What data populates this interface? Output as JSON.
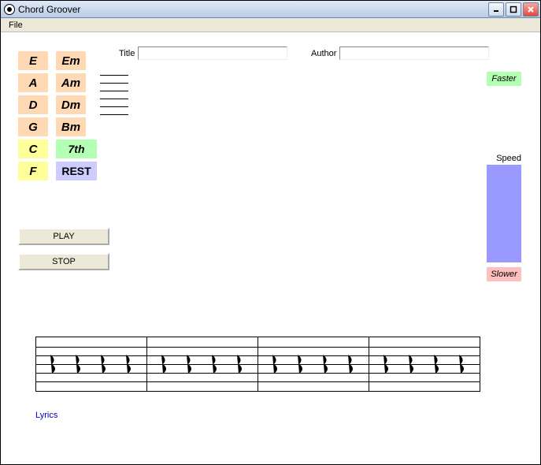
{
  "window": {
    "title": "Chord Groover",
    "menu": {
      "file": "File"
    },
    "buttons": {
      "min": "_",
      "max": "□",
      "close": "X"
    }
  },
  "chords": {
    "col1": [
      "E",
      "A",
      "D",
      "G",
      "C",
      "F"
    ],
    "col2": [
      "Em",
      "Am",
      "Dm",
      "Bm",
      "7th",
      "REST"
    ]
  },
  "fields": {
    "title_label": "Title",
    "title_value": "",
    "author_label": "Author",
    "author_value": ""
  },
  "speed": {
    "faster": "Faster",
    "label": "Speed",
    "slower": "Slower"
  },
  "controls": {
    "play": "PLAY",
    "stop": "STOP"
  },
  "lyrics_label": "Lyrics"
}
